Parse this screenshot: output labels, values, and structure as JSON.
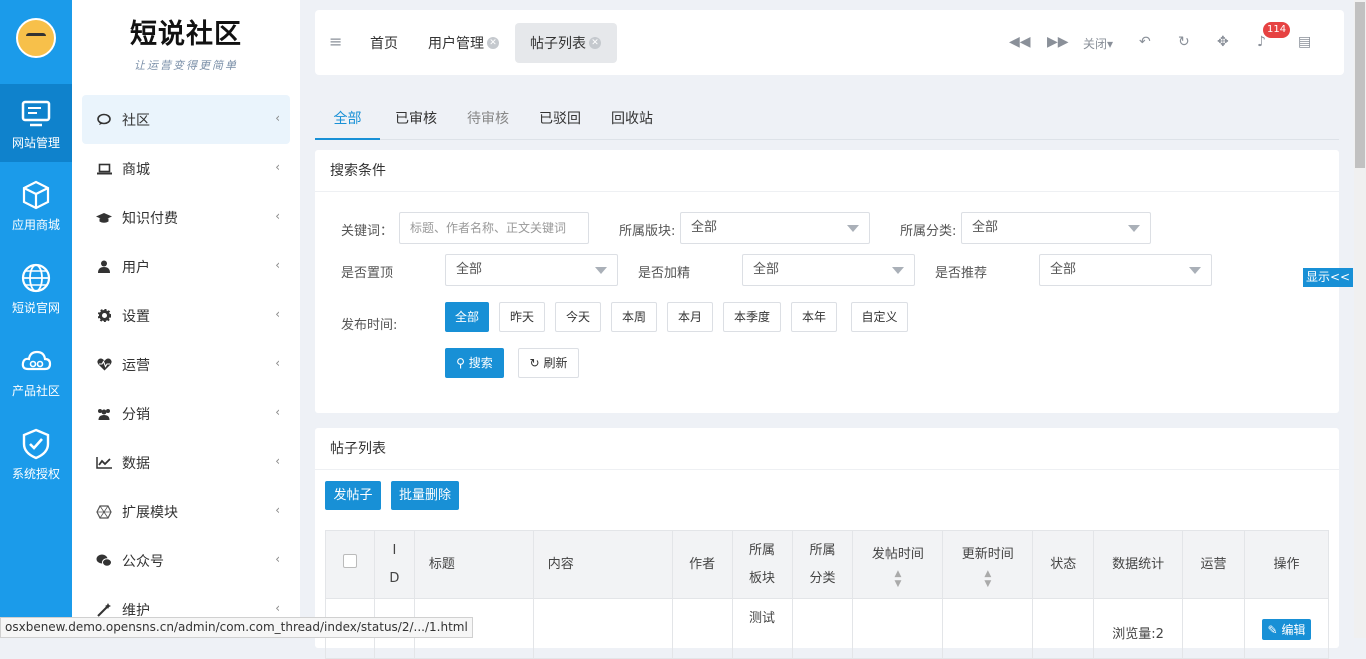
{
  "rail": {
    "items": [
      {
        "label": "网站管理",
        "icon": "monitor-icon"
      },
      {
        "label": "应用商城",
        "icon": "cube-icon"
      },
      {
        "label": "短说官网",
        "icon": "globe-icon"
      },
      {
        "label": "产品社区",
        "icon": "cloud-icon"
      },
      {
        "label": "系统授权",
        "icon": "shield-check-icon"
      }
    ]
  },
  "brand": {
    "title": "短说社区",
    "subtitle": "让运营变得更简单"
  },
  "menu": [
    {
      "label": "社区",
      "icon": "chat-icon",
      "active": true
    },
    {
      "label": "商城",
      "icon": "laptop-icon"
    },
    {
      "label": "知识付费",
      "icon": "graduation-cap-icon"
    },
    {
      "label": "用户",
      "icon": "user-icon"
    },
    {
      "label": "设置",
      "icon": "gear-icon"
    },
    {
      "label": "运营",
      "icon": "heartbeat-icon"
    },
    {
      "label": "分销",
      "icon": "users-icon"
    },
    {
      "label": "数据",
      "icon": "line-chart-icon"
    },
    {
      "label": "扩展模块",
      "icon": "puzzle-icon"
    },
    {
      "label": "公众号",
      "icon": "wechat-icon"
    },
    {
      "label": "维护",
      "icon": "wand-icon"
    }
  ],
  "topbar": {
    "tabs": [
      "首页",
      "用户管理",
      "帖子列表"
    ],
    "close_label": "关闭",
    "notification_count": "114"
  },
  "subtabs": [
    "全部",
    "已审核",
    "待审核",
    "已驳回",
    "回收站"
  ],
  "search": {
    "title": "搜索条件",
    "keyword_label": "关键词：",
    "keyword_placeholder": "标题、作者名称、正文关键词",
    "board_label": "所属版块:",
    "board_value": "全部",
    "category_label": "所属分类:",
    "category_value": "全部",
    "top_label": "是否置顶",
    "top_value": "全部",
    "featured_label": "是否加精",
    "featured_value": "全部",
    "recommend_label": "是否推荐",
    "recommend_value": "全部",
    "time_label": "发布时间:",
    "time_options": [
      "全部",
      "昨天",
      "今天",
      "本周",
      "本月",
      "本季度",
      "本年",
      "自定义"
    ],
    "search_button": "搜索",
    "refresh_button": "刷新",
    "show_button": "显示<<"
  },
  "list": {
    "title": "帖子列表",
    "new_post_button": "发帖子",
    "batch_delete_button": "批量删除",
    "columns": [
      "I D",
      "标题",
      "内容",
      "作者",
      "所属板块",
      "所属分类",
      "发帖时间",
      "更新时间",
      "状态",
      "数据统计",
      "运营",
      "操作"
    ],
    "row1": {
      "board": "测试",
      "stats": "浏览量:2",
      "edit": "编辑"
    }
  },
  "statusbar": {
    "url": "osxbenew.demo.opensns.cn/admin/com.com_thread/index/status/2/.../1.html"
  }
}
